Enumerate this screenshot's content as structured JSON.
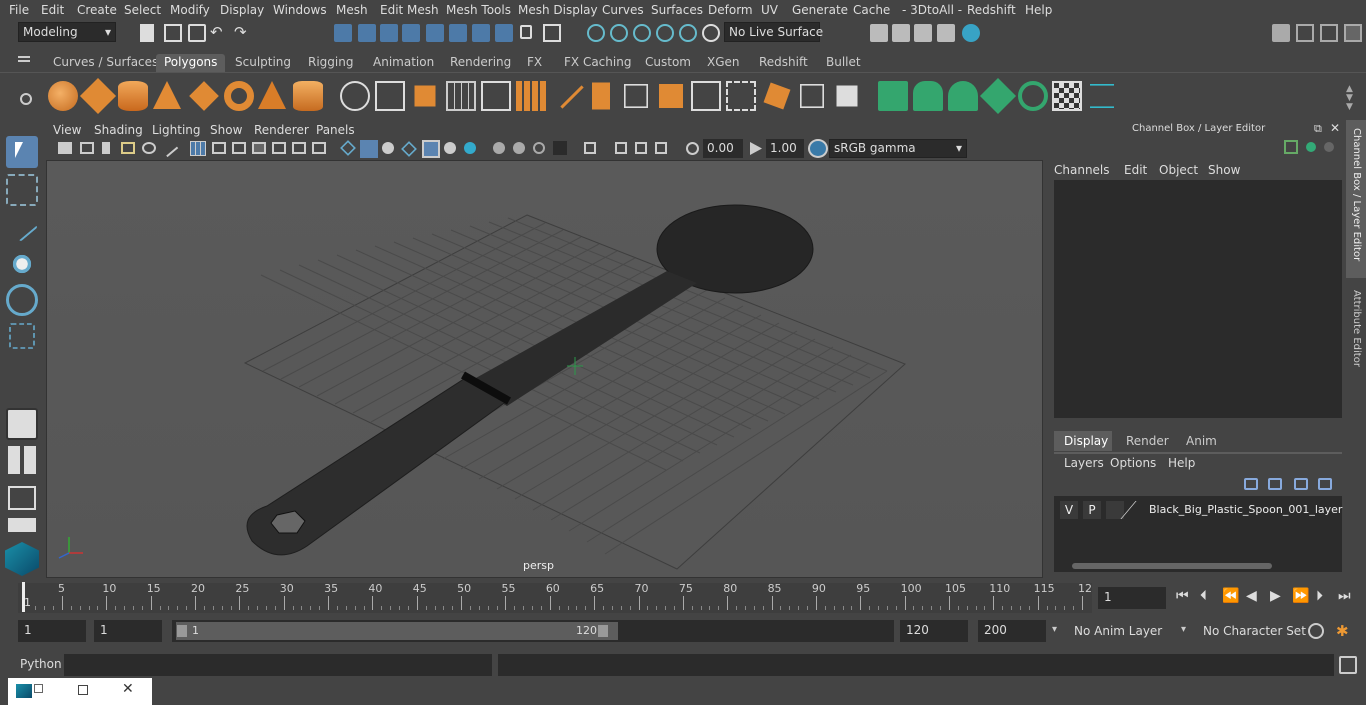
{
  "menu": [
    "File",
    "Edit",
    "Create",
    "Select",
    "Modify",
    "Display",
    "Windows",
    "Mesh",
    "Edit Mesh",
    "Mesh Tools",
    "Mesh Display",
    "Curves",
    "Surfaces",
    "Deform",
    "UV",
    "Generate",
    "Cache",
    "- 3DtoAll -",
    "Redshift",
    "Help"
  ],
  "mode": "Modeling",
  "live_surface": "No Live Surface",
  "shelf_tabs": [
    "Curves / Surfaces",
    "Polygons",
    "Sculpting",
    "Rigging",
    "Animation",
    "Rendering",
    "FX",
    "FX Caching",
    "Custom",
    "XGen",
    "Redshift",
    "Bullet"
  ],
  "active_shelf": "Polygons",
  "viewport_menu": [
    "View",
    "Shading",
    "Lighting",
    "Show",
    "Renderer",
    "Panels"
  ],
  "exposure": "0.00",
  "gamma": "1.00",
  "color_space": "sRGB gamma",
  "camera": "persp",
  "channel_box_title": "Channel Box / Layer Editor",
  "channel_menu": [
    "Channels",
    "Edit",
    "Object",
    "Show"
  ],
  "layer_tabs": [
    "Display",
    "Render",
    "Anim"
  ],
  "layer_menu": [
    "Layers",
    "Options",
    "Help"
  ],
  "layer": {
    "v": "V",
    "p": "P",
    "name": "Black_Big_Plastic_Spoon_001_layer"
  },
  "side_tabs": [
    "Channel Box / Layer Editor",
    "Attribute Editor"
  ],
  "ticks": [
    "5",
    "10",
    "15",
    "20",
    "25",
    "30",
    "35",
    "40",
    "45",
    "50",
    "55",
    "60",
    "65",
    "70",
    "75",
    "80",
    "85",
    "90",
    "95",
    "100",
    "105",
    "110",
    "115",
    "12"
  ],
  "current_frame": "1",
  "timeline_start": "1",
  "range": {
    "start": "1",
    "playstart": "1",
    "slider_start": "1",
    "slider_end": "120",
    "end": "120",
    "max": "200"
  },
  "anim_layer": "No Anim Layer",
  "char_set": "No Character Set",
  "python_label": "Python"
}
